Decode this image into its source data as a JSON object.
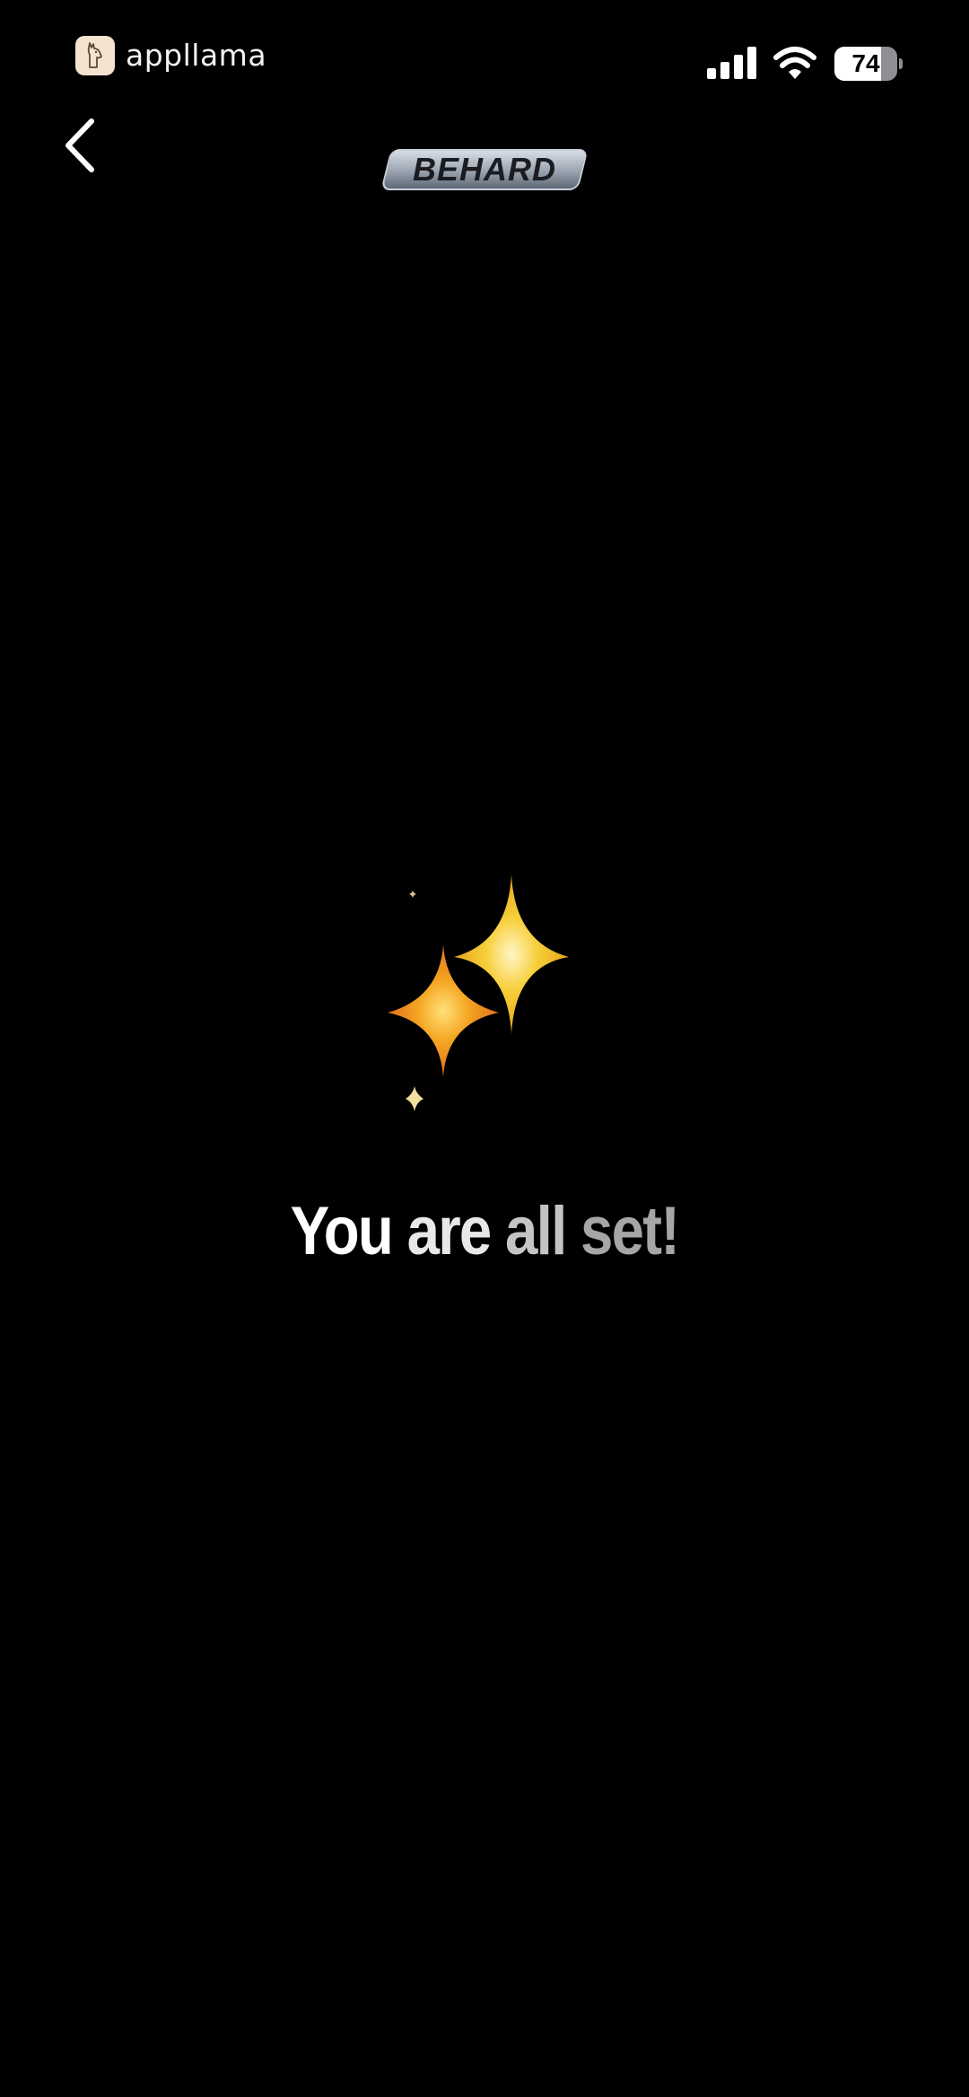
{
  "status_bar": {
    "app_name": "appllama",
    "battery_percent": 74,
    "battery_label": "74",
    "icons": [
      "llama-icon",
      "signal-icon",
      "wifi-icon",
      "battery-icon"
    ]
  },
  "header": {
    "back_icon": "chevron-left-icon",
    "logo_text": "BEHARD"
  },
  "main": {
    "illustration": "sparkles-icon",
    "headline_words": [
      "You",
      "are",
      "all",
      "set!"
    ]
  },
  "colors": {
    "background": "#000000",
    "text_primary": "#ffffff",
    "sparkle_large": "#f2c230",
    "sparkle_orange": "#f08a1c"
  }
}
